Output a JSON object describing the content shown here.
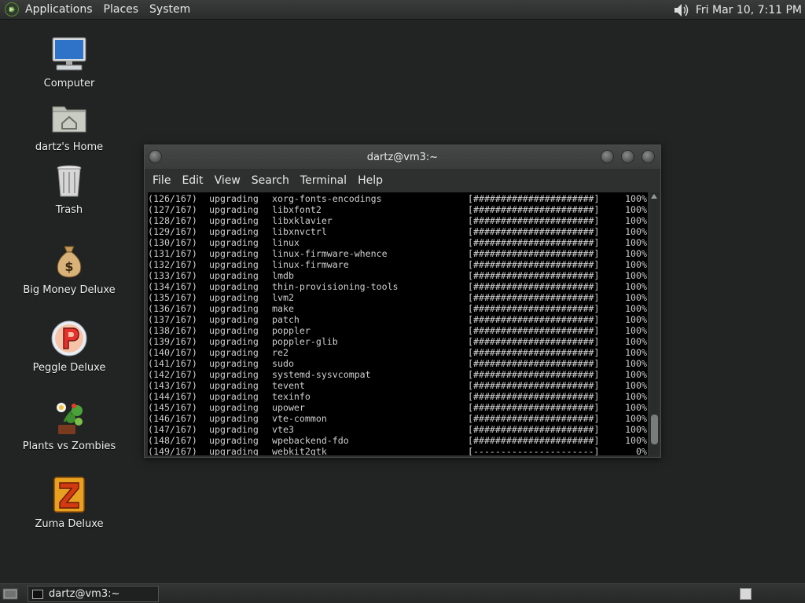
{
  "top_panel": {
    "menus": [
      "Applications",
      "Places",
      "System"
    ],
    "clock": "Fri Mar 10,  7:11 PM"
  },
  "desktop_icons": [
    {
      "label": "Computer",
      "icon": "computer-icon"
    },
    {
      "label": "dartz's Home",
      "icon": "home-folder-icon"
    },
    {
      "label": "Trash",
      "icon": "trash-icon"
    },
    {
      "label": "Big Money Deluxe",
      "icon": "money-bag-icon"
    },
    {
      "label": "Peggle Deluxe",
      "icon": "peggle-icon"
    },
    {
      "label": "Plants vs Zombies",
      "icon": "plants-icon"
    },
    {
      "label": "Zuma Deluxe",
      "icon": "zuma-icon"
    }
  ],
  "terminal": {
    "title": "dartz@vm3:~",
    "menu": [
      "File",
      "Edit",
      "View",
      "Search",
      "Terminal",
      "Help"
    ],
    "lines": [
      {
        "count": "(126/167)",
        "action": "upgrading",
        "pkg": "xorg-fonts-encodings",
        "bar": "[######################]",
        "pct": "100%"
      },
      {
        "count": "(127/167)",
        "action": "upgrading",
        "pkg": "libxfont2",
        "bar": "[######################]",
        "pct": "100%"
      },
      {
        "count": "(128/167)",
        "action": "upgrading",
        "pkg": "libxklavier",
        "bar": "[######################]",
        "pct": "100%"
      },
      {
        "count": "(129/167)",
        "action": "upgrading",
        "pkg": "libxnvctrl",
        "bar": "[######################]",
        "pct": "100%"
      },
      {
        "count": "(130/167)",
        "action": "upgrading",
        "pkg": "linux",
        "bar": "[######################]",
        "pct": "100%"
      },
      {
        "count": "(131/167)",
        "action": "upgrading",
        "pkg": "linux-firmware-whence",
        "bar": "[######################]",
        "pct": "100%"
      },
      {
        "count": "(132/167)",
        "action": "upgrading",
        "pkg": "linux-firmware",
        "bar": "[######################]",
        "pct": "100%"
      },
      {
        "count": "(133/167)",
        "action": "upgrading",
        "pkg": "lmdb",
        "bar": "[######################]",
        "pct": "100%"
      },
      {
        "count": "(134/167)",
        "action": "upgrading",
        "pkg": "thin-provisioning-tools",
        "bar": "[######################]",
        "pct": "100%"
      },
      {
        "count": "(135/167)",
        "action": "upgrading",
        "pkg": "lvm2",
        "bar": "[######################]",
        "pct": "100%"
      },
      {
        "count": "(136/167)",
        "action": "upgrading",
        "pkg": "make",
        "bar": "[######################]",
        "pct": "100%"
      },
      {
        "count": "(137/167)",
        "action": "upgrading",
        "pkg": "patch",
        "bar": "[######################]",
        "pct": "100%"
      },
      {
        "count": "(138/167)",
        "action": "upgrading",
        "pkg": "poppler",
        "bar": "[######################]",
        "pct": "100%"
      },
      {
        "count": "(139/167)",
        "action": "upgrading",
        "pkg": "poppler-glib",
        "bar": "[######################]",
        "pct": "100%"
      },
      {
        "count": "(140/167)",
        "action": "upgrading",
        "pkg": "re2",
        "bar": "[######################]",
        "pct": "100%"
      },
      {
        "count": "(141/167)",
        "action": "upgrading",
        "pkg": "sudo",
        "bar": "[######################]",
        "pct": "100%"
      },
      {
        "count": "(142/167)",
        "action": "upgrading",
        "pkg": "systemd-sysvcompat",
        "bar": "[######################]",
        "pct": "100%"
      },
      {
        "count": "(143/167)",
        "action": "upgrading",
        "pkg": "tevent",
        "bar": "[######################]",
        "pct": "100%"
      },
      {
        "count": "(144/167)",
        "action": "upgrading",
        "pkg": "texinfo",
        "bar": "[######################]",
        "pct": "100%"
      },
      {
        "count": "(145/167)",
        "action": "upgrading",
        "pkg": "upower",
        "bar": "[######################]",
        "pct": "100%"
      },
      {
        "count": "(146/167)",
        "action": "upgrading",
        "pkg": "vte-common",
        "bar": "[######################]",
        "pct": "100%"
      },
      {
        "count": "(147/167)",
        "action": "upgrading",
        "pkg": "vte3",
        "bar": "[######################]",
        "pct": "100%"
      },
      {
        "count": "(148/167)",
        "action": "upgrading",
        "pkg": "wpebackend-fdo",
        "bar": "[######################]",
        "pct": "100%"
      },
      {
        "count": "(149/167)",
        "action": "upgrading",
        "pkg": "webkit2gtk",
        "bar": "[----------------------]",
        "pct": "0%"
      }
    ]
  },
  "taskbar": {
    "window_button": "dartz@vm3:~"
  },
  "colors": {
    "desktop_bg": "#222423",
    "terminal_bg": "#000000",
    "terminal_fg": "#cfcfcf"
  }
}
